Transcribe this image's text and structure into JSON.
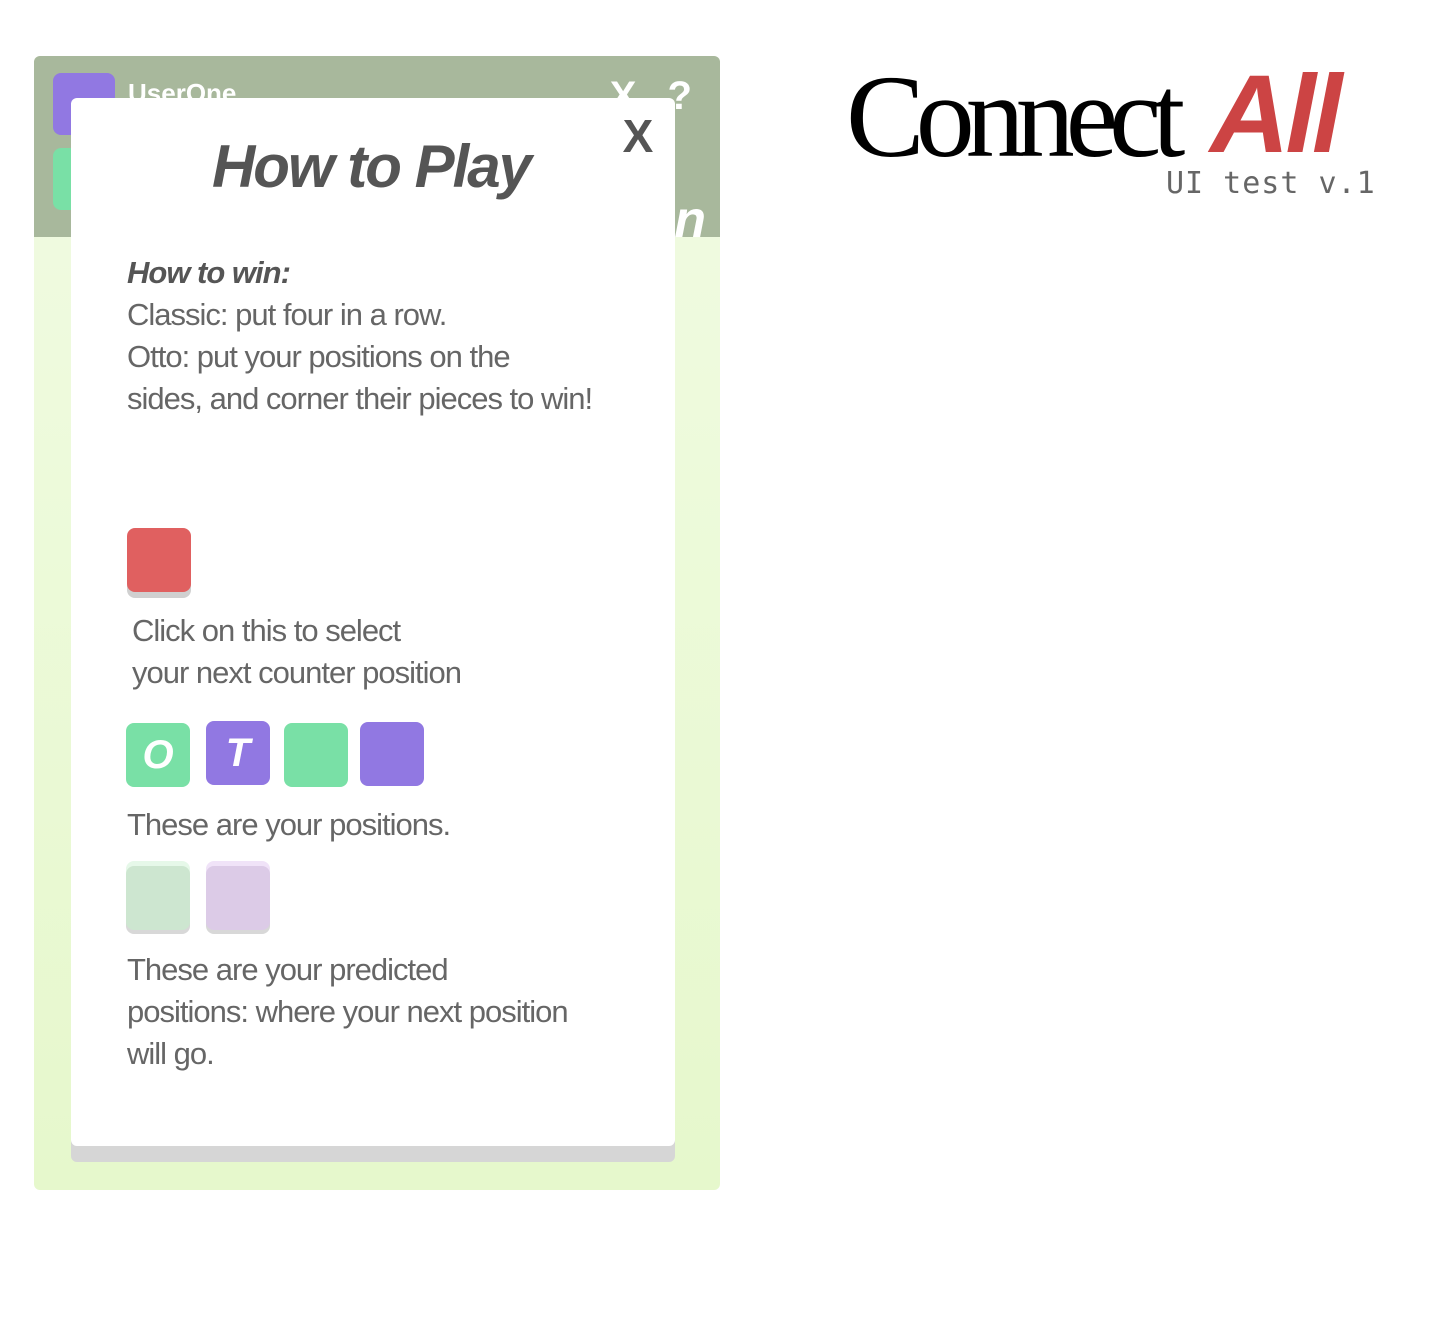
{
  "background_panel": {
    "username": "UserOne",
    "header_icons": "X ?",
    "header_right_text": "n"
  },
  "modal": {
    "title": "How to Play",
    "close_label": "X",
    "win_heading": "How to win:",
    "win_classic": "Classic: put four in a row.",
    "win_otto_line1": "Otto: put your positions on the",
    "win_otto_line2": "sides, and corner their pieces to win!",
    "select_text_line1": "Click on this to select",
    "select_text_line2": "your next counter position",
    "position_tiles": [
      {
        "label": "O",
        "color": "#79e0a6"
      },
      {
        "label": "T",
        "color": "#9178e2"
      },
      {
        "label": "",
        "color": "#79e0a6"
      },
      {
        "label": "",
        "color": "#9178e2"
      }
    ],
    "positions_text": "These are your positions.",
    "predicted_text_line1": "These are your predicted",
    "predicted_text_line2": "positions: where your next position",
    "predicted_text_line3": "will go."
  },
  "logo": {
    "connect": "Connect",
    "all": "All",
    "subtitle": "UI test v.1"
  },
  "colors": {
    "header_bg": "#a8b89c",
    "select_tile": "#e06060",
    "green": "#79e0a6",
    "purple": "#9178e2",
    "logo_red": "#cc4444"
  }
}
